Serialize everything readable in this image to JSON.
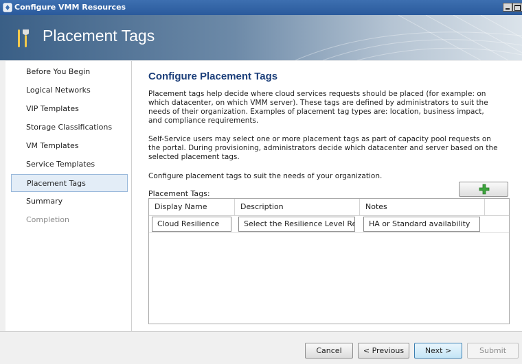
{
  "window": {
    "title": "Configure VMM Resources"
  },
  "banner": {
    "title": "Placement Tags",
    "icon": "tools-icon"
  },
  "sidebar": {
    "items": [
      {
        "label": "Before You Begin",
        "state": "normal"
      },
      {
        "label": "Logical Networks",
        "state": "normal"
      },
      {
        "label": "VIP Templates",
        "state": "normal"
      },
      {
        "label": "Storage Classifications",
        "state": "normal"
      },
      {
        "label": "VM Templates",
        "state": "normal"
      },
      {
        "label": "Service Templates",
        "state": "normal"
      },
      {
        "label": "Placement Tags",
        "state": "selected"
      },
      {
        "label": "Summary",
        "state": "normal"
      },
      {
        "label": "Completion",
        "state": "disabled"
      }
    ]
  },
  "content": {
    "heading": "Configure Placement Tags",
    "para1": "Placement tags help decide where cloud services requests should be placed (for example: on which datacenter, on which VMM server). These tags are defined by administrators to suit the needs of their organization. Examples of placement tag types are: location, business impact, and compliance requirements.",
    "para2": "Self-Service users may select one or more placement tags as part of capacity pool requests on the portal. During provisioning, administrators decide which datacenter and server based on the selected placement tags.",
    "para3": "Configure placement tags to suit the needs of your organization.",
    "tags_label": "Placement Tags:",
    "add_icon": "green-plus-icon",
    "columns": [
      "Display Name",
      "Description",
      "Notes"
    ],
    "rows": [
      {
        "display_name": "Cloud Resilience",
        "description": "Select the Resilience Level Requ",
        "notes": "HA or Standard availability"
      }
    ]
  },
  "footer": {
    "cancel": "Cancel",
    "previous": "< Previous",
    "next": "Next >",
    "submit": "Submit"
  },
  "colors": {
    "title_bar": "#2a5a9c",
    "heading": "#1c3f7a",
    "selected_nav": "#e3edf7",
    "add_icon": "#3da53d"
  }
}
